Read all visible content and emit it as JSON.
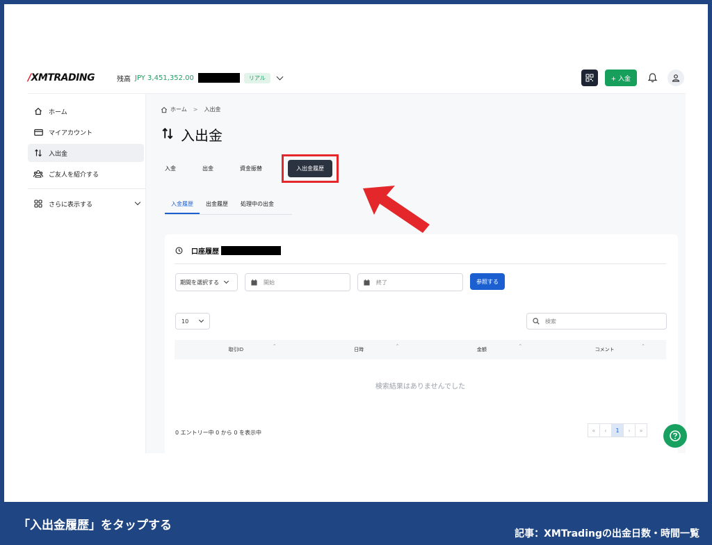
{
  "header": {
    "logo_text": "XMTRADING",
    "balance_label": "残高",
    "balance_value": "JPY 3,451,352.00",
    "account_badge": "リアル",
    "deposit_button": "+ 入金"
  },
  "sidebar": {
    "items": [
      {
        "label": "ホーム",
        "icon": "home-icon"
      },
      {
        "label": "マイアカウント",
        "icon": "card-icon"
      },
      {
        "label": "入出金",
        "icon": "transfer-icon"
      },
      {
        "label": "ご友人を紹介する",
        "icon": "people-icon"
      }
    ],
    "more_label": "さらに表示する"
  },
  "main": {
    "breadcrumb_home": "ホーム",
    "breadcrumb_current": "入出金",
    "page_title": "入出金",
    "tabs": [
      "入金",
      "出金",
      "資金振替",
      "入出金履歴"
    ],
    "active_tab": "入出金履歴",
    "subtabs": [
      "入金履歴",
      "出金履歴",
      "処理中の出金"
    ],
    "active_subtab": "入金履歴"
  },
  "history": {
    "title": "口座履歴",
    "period_select": "期間を選択する",
    "start_placeholder": "開始",
    "end_placeholder": "終了",
    "lookup_button": "参照する",
    "page_size": "10",
    "search_placeholder": "検索",
    "columns": [
      "取引ID",
      "日時",
      "金額",
      "コメント"
    ],
    "empty_message": "検索結果はありませんでした",
    "entries_info": "0 エントリー中 0 から 0 を表示中",
    "pager": [
      "«",
      "‹",
      "1",
      "›",
      "»"
    ]
  },
  "caption": {
    "instruction": "「入出金履歴」をタップする",
    "article": "記事：XMTradingの出金日数・時間一覧"
  },
  "colors": {
    "brand_green": "#16a05c",
    "accent_blue": "#1c5fd1",
    "highlight_red": "#e3272b",
    "frame_navy": "#1f4682"
  }
}
